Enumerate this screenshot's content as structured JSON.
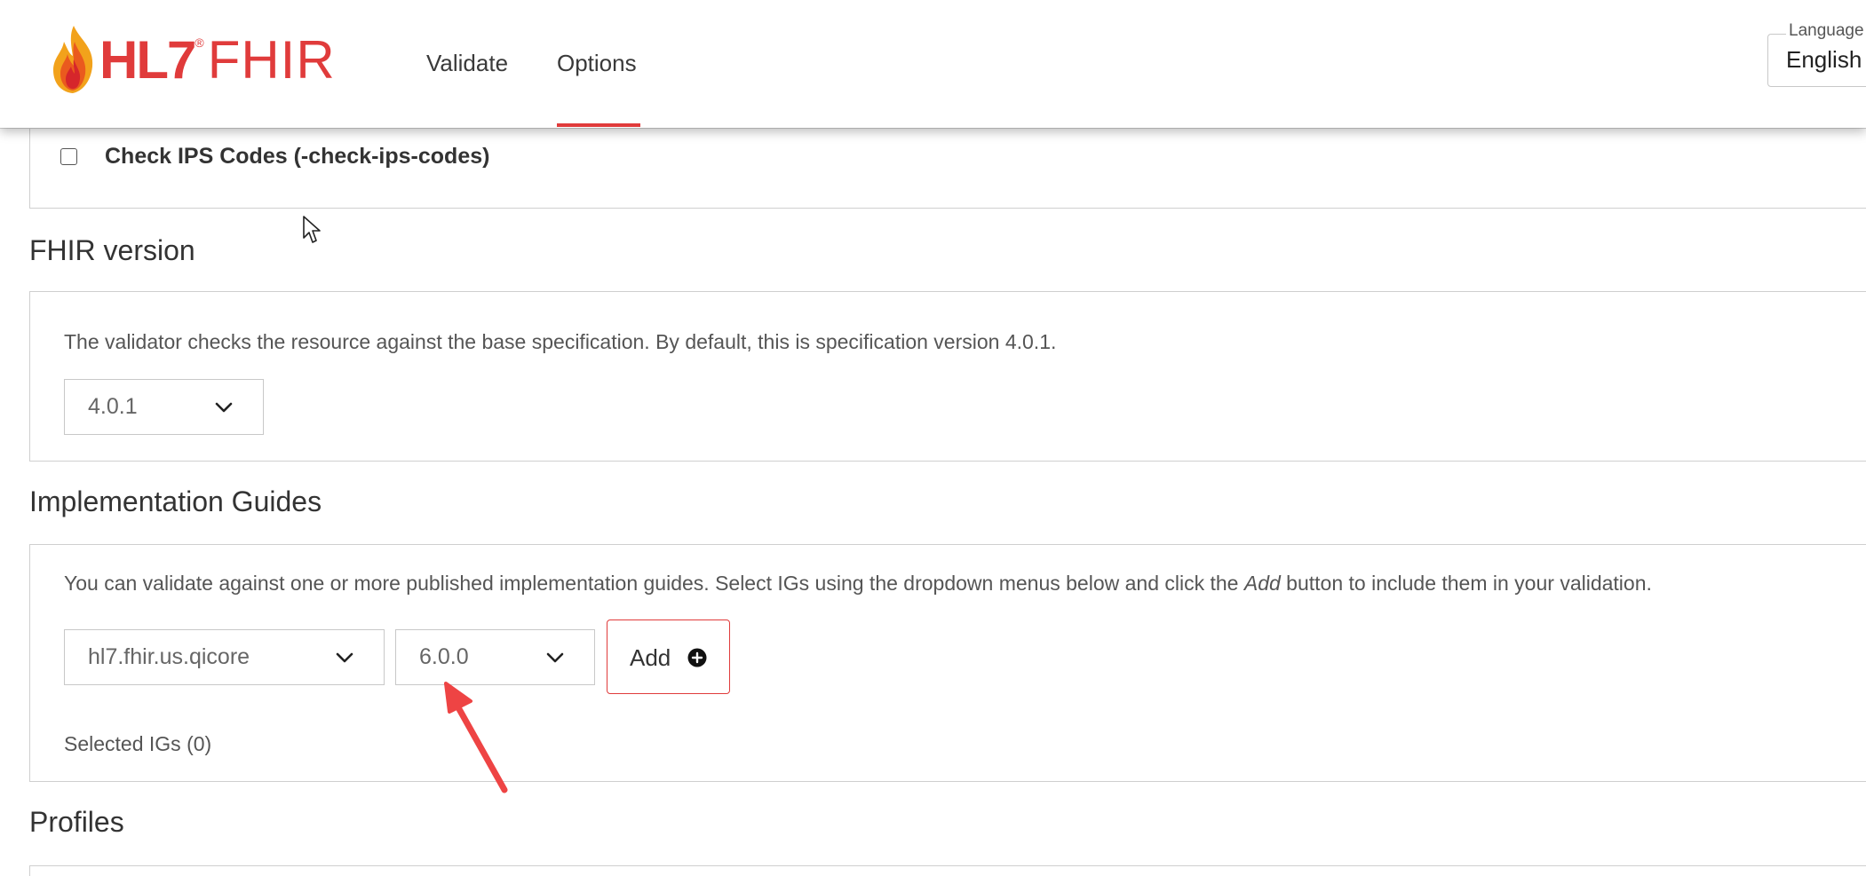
{
  "header": {
    "logo": {
      "mark": "HL7",
      "reg": "®",
      "word": "FHIR"
    },
    "tabs": [
      {
        "label": "Validate",
        "active": false
      },
      {
        "label": "Options",
        "active": true
      }
    ],
    "language": {
      "label": "Language",
      "value": "English"
    }
  },
  "options": {
    "check_ips": {
      "label": "Check IPS Codes (-check-ips-codes)",
      "checked": false
    }
  },
  "fhir_version": {
    "title": "FHIR version",
    "help": "The validator checks the resource against the base specification. By default, this is specification version 4.0.1.",
    "selected": "4.0.1"
  },
  "implementation_guides": {
    "title": "Implementation Guides",
    "help_before": "You can validate against one or more published implementation guides. Select IGs using the dropdown menus below and click the ",
    "help_em": "Add",
    "help_after": " button to include them in your validation.",
    "ig_name": "hl7.fhir.us.qicore",
    "ig_version": "6.0.0",
    "add_label": "Add",
    "selected_igs": "Selected IGs (0)"
  },
  "profiles": {
    "title": "Profiles"
  },
  "colors": {
    "brand_red": "#e03b3b",
    "annotation_arrow": "#ee4444"
  },
  "icons": {
    "dropdown": "chevron-down-icon",
    "add": "plus-circle-icon",
    "logo_flame": "flame-icon",
    "cursor": "mouse-pointer-icon",
    "annotation": "annotation-arrow-icon"
  }
}
